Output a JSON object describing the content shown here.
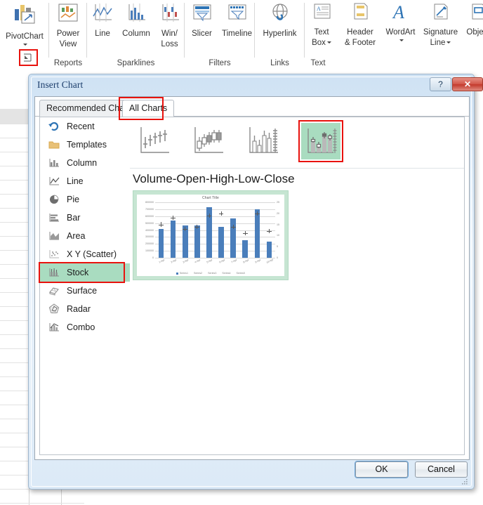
{
  "ribbon": {
    "groups": [
      {
        "name": "",
        "buttons": [
          {
            "label": "PivotChart",
            "icon": "pivotchart-icon",
            "dropdown": true
          }
        ]
      },
      {
        "name": "Reports",
        "buttons": [
          {
            "label": "Power\nView",
            "icon": "power-view-icon",
            "dropdown": false
          }
        ]
      },
      {
        "name": "Sparklines",
        "buttons": [
          {
            "label": "Line",
            "icon": "sparkline-line-icon",
            "dropdown": false
          },
          {
            "label": "Column",
            "icon": "sparkline-column-icon",
            "dropdown": false
          },
          {
            "label": "Win/\nLoss",
            "icon": "sparkline-winloss-icon",
            "dropdown": false
          }
        ]
      },
      {
        "name": "Filters",
        "buttons": [
          {
            "label": "Slicer",
            "icon": "slicer-icon",
            "dropdown": false
          },
          {
            "label": "Timeline",
            "icon": "timeline-icon",
            "dropdown": false
          }
        ]
      },
      {
        "name": "Links",
        "buttons": [
          {
            "label": "Hyperlink",
            "icon": "hyperlink-icon",
            "dropdown": false
          }
        ]
      },
      {
        "name": "Text",
        "buttons": [
          {
            "label": "Text\nBox",
            "icon": "text-box-icon",
            "dropdown": true
          },
          {
            "label": "Header\n& Footer",
            "icon": "header-footer-icon",
            "dropdown": false
          },
          {
            "label": "WordArt",
            "icon": "wordart-icon",
            "dropdown": true
          },
          {
            "label": "Signature\nLine",
            "icon": "signature-line-icon",
            "dropdown": true
          },
          {
            "label": "Object",
            "icon": "object-icon",
            "dropdown": false
          }
        ]
      }
    ],
    "labels": {
      "pivotchart": "PivotChart",
      "power_view_1": "Power",
      "power_view_2": "View",
      "line": "Line",
      "column": "Column",
      "winloss_1": "Win/",
      "winloss_2": "Loss",
      "slicer": "Slicer",
      "timeline": "Timeline",
      "hyperlink": "Hyperlink",
      "textbox_1": "Text",
      "textbox_2": "Box",
      "header_1": "Header",
      "header_2": "& Footer",
      "wordart": "WordArt",
      "signature_1": "Signature",
      "signature_2": "Line",
      "object": "Object"
    },
    "group_names": {
      "reports": "Reports",
      "sparklines": "Sparklines",
      "filters": "Filters",
      "links": "Links",
      "text": "Text"
    }
  },
  "dialog": {
    "title": "Insert Chart",
    "help_button": "?",
    "close_button": "✕",
    "tabs": [
      {
        "id": "recommended",
        "label": "Recommended Charts",
        "selected": false
      },
      {
        "id": "all",
        "label": "All Charts",
        "selected": true,
        "highlighted": true
      }
    ],
    "tab_recommended_label": "Recommended Charts",
    "tab_all_label": "All Charts",
    "type_list": [
      {
        "label": "Recent",
        "icon": "recent-icon",
        "selected": false
      },
      {
        "label": "Templates",
        "icon": "templates-icon",
        "selected": false
      },
      {
        "label": "Column",
        "icon": "column-chart-icon",
        "selected": false
      },
      {
        "label": "Line",
        "icon": "line-chart-icon",
        "selected": false
      },
      {
        "label": "Pie",
        "icon": "pie-chart-icon",
        "selected": false
      },
      {
        "label": "Bar",
        "icon": "bar-chart-icon",
        "selected": false
      },
      {
        "label": "Area",
        "icon": "area-chart-icon",
        "selected": false
      },
      {
        "label": "X Y (Scatter)",
        "icon": "scatter-chart-icon",
        "selected": false
      },
      {
        "label": "Stock",
        "icon": "stock-chart-icon",
        "selected": true,
        "highlighted": true
      },
      {
        "label": "Surface",
        "icon": "surface-chart-icon",
        "selected": false
      },
      {
        "label": "Radar",
        "icon": "radar-chart-icon",
        "selected": false
      },
      {
        "label": "Combo",
        "icon": "combo-chart-icon",
        "selected": false
      }
    ],
    "subtypes": [
      {
        "name": "High-Low-Close",
        "icon": "stock-hlc-icon",
        "selected": false
      },
      {
        "name": "Open-High-Low-Close",
        "icon": "stock-ohlc-icon",
        "selected": false
      },
      {
        "name": "Volume-High-Low-Close",
        "icon": "stock-vhlc-icon",
        "selected": false
      },
      {
        "name": "Volume-Open-High-Low-Close",
        "icon": "stock-vohlc-icon",
        "selected": true,
        "highlighted": true
      }
    ],
    "preview_title": "Volume-Open-High-Low-Close",
    "buttons": {
      "ok": "OK",
      "cancel": "Cancel"
    }
  },
  "chart_data": {
    "type": "bar",
    "title": "Chart Title",
    "categories": [
      "1-Apr",
      "2-Apr",
      "3-Apr",
      "4-Apr",
      "5-Apr",
      "6-Apr",
      "7-Apr",
      "8-Apr",
      "9-Apr",
      "10-Apr"
    ],
    "series": [
      {
        "name": "Series1",
        "axis": "primary",
        "values": [
          420000,
          540000,
          470000,
          470000,
          730000,
          450000,
          570000,
          250000,
          700000,
          230000
        ]
      },
      {
        "name": "Series2",
        "axis": "secondary",
        "values": [
          15,
          18,
          13,
          14,
          19,
          20,
          14,
          11,
          20,
          12
        ]
      },
      {
        "name": "Series3",
        "axis": "secondary",
        "values": [
          16,
          19,
          14,
          15,
          20,
          21,
          15,
          12,
          21,
          13
        ]
      },
      {
        "name": "Series4",
        "axis": "secondary",
        "values": [
          14,
          17,
          12,
          13,
          18,
          19,
          13,
          10,
          19,
          11
        ]
      },
      {
        "name": "Series5",
        "axis": "secondary",
        "values": [
          15,
          18,
          13,
          14,
          19,
          20,
          14,
          11,
          20,
          12
        ]
      }
    ],
    "legend": [
      "Series1",
      "Series2",
      "Series3",
      "Series4",
      "Series5"
    ],
    "legend_position": "bottom",
    "grid": true,
    "xlabel": "",
    "ylabel": "",
    "ylim": [
      0,
      800000
    ],
    "yticks": [
      "0",
      "100000",
      "200000",
      "300000",
      "400000",
      "500000",
      "600000",
      "700000",
      "800000"
    ],
    "y2lim": [
      0,
      25
    ],
    "y2ticks": [
      "0",
      "5",
      "10",
      "15",
      "20",
      "25"
    ]
  },
  "colors": {
    "annotation_red": "#e8130e",
    "selection_green": "#a9dcc0",
    "bar_blue": "#4a7ebb",
    "title_blue": "#1b3d6b"
  }
}
